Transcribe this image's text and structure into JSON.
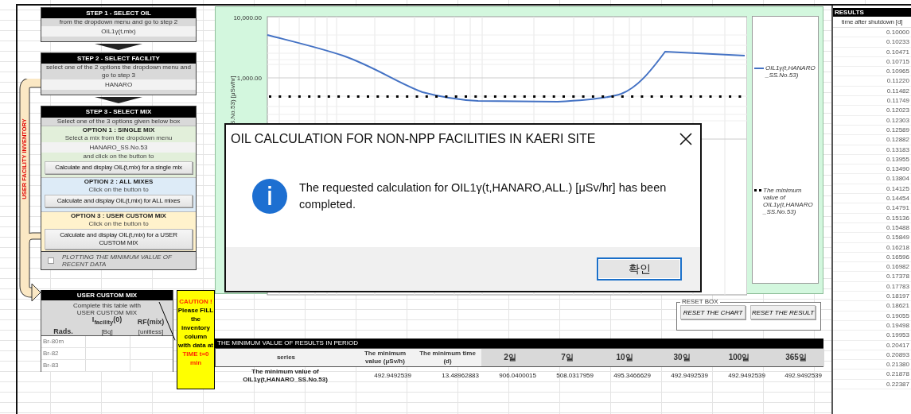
{
  "step1": {
    "title": "STEP 1 - SELECT OIL",
    "hint": "from the dropdown menu and go to step 2",
    "value": "OIL1γ(t,mix)"
  },
  "step2": {
    "title": "STEP 2 - SELECT FACILITY",
    "hint": "select one of the 2 options the dropdown menu and go to step 3",
    "value": "HANARO"
  },
  "step3": {
    "title": "STEP 3 - SELECT MIX",
    "hint": "Select one of the 3 options given below box",
    "options": [
      {
        "kind": "single",
        "title": "OPTION 1 : SINGLE MIX",
        "hint": "Select a mix from the dropdown menu",
        "value": "HANARO_SS.No.53",
        "after": "and click on the button to",
        "button": "Calculate and display OIL(t,mix) for a single mix"
      },
      {
        "kind": "all",
        "title": "OPTION 2 : ALL MIXES",
        "hint": "Click on the button to",
        "button": "Calculate and display OIL(t,mix) for  ALL mixes"
      },
      {
        "kind": "custom",
        "title": "OPTION 3 : USER CUSTOM MIX",
        "hint": "Click on the button to",
        "button": "Calculate and display OIL(t,mix) for a USER CUSTOM MIX"
      }
    ]
  },
  "plot_checkbox": {
    "label": "PLOTTING THE MINIMUM VALUE OF RECENT DATA",
    "checked": false
  },
  "connector_label": "USER FACILITY INVENTORY",
  "custom_mix": {
    "title": "USER CUSTOM MIX",
    "note": "Complete this table with USER CUSTOM MIX",
    "columns": [
      {
        "label": "Rads."
      },
      {
        "label": "I$_{facility}$(0)",
        "unit": "[Bq]"
      },
      {
        "label": "RF(mix)",
        "unit": "[unitless]"
      }
    ],
    "rows": [
      "Br-80m",
      "Br-82",
      "Br-83"
    ]
  },
  "caution": [
    {
      "text": "CAUTION !",
      "alert": true
    },
    {
      "text": "Please FILL the inventory column with data at",
      "alert": false
    },
    {
      "text": "TIME t=0 min",
      "alert": true
    }
  ],
  "chart": {
    "y_ticks": [
      "10,000.00",
      "1,000.00"
    ],
    "y_title": "S.No.53) [μSv/hr]",
    "legend": [
      {
        "kind": "line",
        "label": "OIL1γ(t,HANARO_SS.No.53)"
      },
      {
        "kind": "dots",
        "label": "The minimum value of OIL1γ(t,HANARO_SS.No.53)"
      }
    ]
  },
  "dialog": {
    "title": "OIL CALCULATION FOR NON-NPP FACILITIES IN KAERI SITE",
    "message": "The requested calculation for OIL1γ(t,HANARO,ALL.) [μSv/hr] has been completed.",
    "button": "확인"
  },
  "reset_box": {
    "title": "RESET BOX",
    "buttons": [
      "RESET THE CHART",
      "RESET THE RESULT"
    ]
  },
  "min_table": {
    "title": "THE MINIMUM VALUE OF RESULTS IN PERIOD",
    "columns": [
      "series",
      "The minimum value (μSv/h)",
      "The minimum time (d)",
      "2일",
      "7일",
      "10일",
      "30일",
      "100일",
      "365일"
    ],
    "rows": [
      [
        "The minimum value of OIL1γ(t,HANARO_SS.No.53)",
        "492.9492539",
        "13.48962883",
        "906.0400015",
        "508.0317959",
        "495.3466629",
        "492.9492539",
        "492.9492539",
        "492.9492539"
      ]
    ]
  },
  "results": {
    "title": "RESULTS",
    "column": "time after shutdown [d]",
    "values": [
      "0.10000",
      "0.10233",
      "0.10471",
      "0.10715",
      "0.10965",
      "0.11220",
      "0.11482",
      "0.11749",
      "0.12023",
      "0.12303",
      "0.12589",
      "0.12882",
      "0.13183",
      "0.13955",
      "0.13490",
      "0.13804",
      "0.14125",
      "0.14454",
      "0.14791",
      "0.15136",
      "0.15488",
      "0.15849",
      "0.16218",
      "0.16596",
      "0.16982",
      "0.17378",
      "0.17783",
      "0.18197",
      "0.18621",
      "0.19055",
      "0.19498",
      "0.19953",
      "0.20417",
      "0.20893",
      "0.21380",
      "0.21878",
      "0.22387"
    ]
  }
}
